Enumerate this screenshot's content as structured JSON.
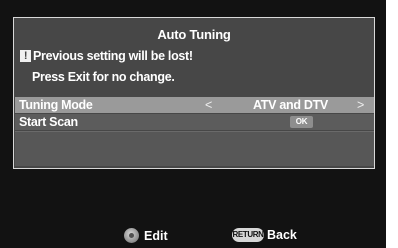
{
  "dialog": {
    "title": "Auto Tuning",
    "warning_icon": "info-icon",
    "warning_icon_glyph": "!",
    "warning_text": "Previous setting will be lost!",
    "note_text": "Press Exit for no change."
  },
  "menu": {
    "tuning_mode": {
      "label": "Tuning Mode",
      "left_arrow": "<",
      "value": "ATV and DTV",
      "right_arrow": ">"
    },
    "start_scan": {
      "label": "Start Scan",
      "ok_label": "OK"
    }
  },
  "footer": {
    "edit_icon": "dpad-icon",
    "edit_label": "Edit",
    "back_icon": "return-button-icon",
    "back_icon_text": "RETURN",
    "back_label": "Back"
  },
  "colors": {
    "screen_background": "#121212",
    "panel_background": "#474747",
    "selected_row": "#9a9a9a",
    "text": "#ffffff"
  }
}
